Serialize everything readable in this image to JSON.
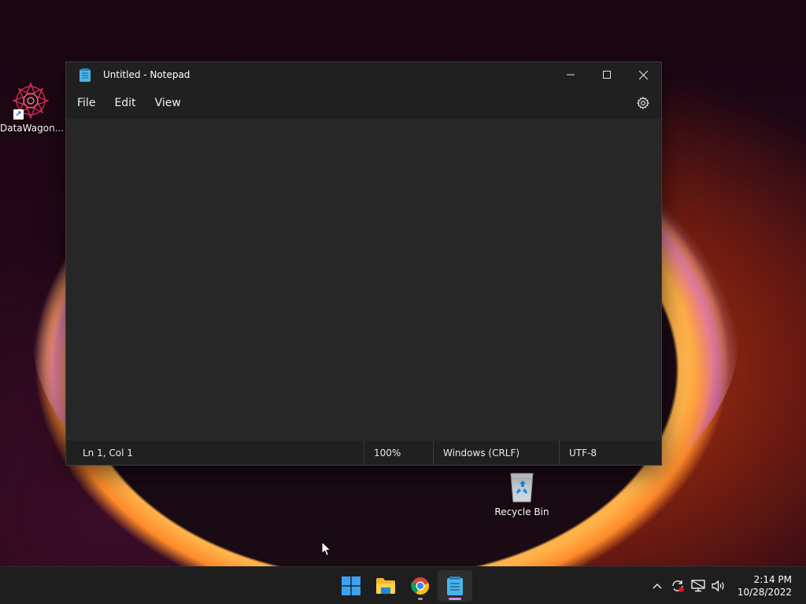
{
  "desktop": {
    "icons": [
      {
        "label": "DataWagon...",
        "icon": "datawagon-app-icon"
      },
      {
        "label": "Recycle Bin",
        "icon": "recycle-bin-icon"
      }
    ]
  },
  "window": {
    "title": "Untitled - Notepad",
    "app_icon": "notepad-icon",
    "controls": {
      "minimize": "minimize-icon",
      "maximize": "maximize-icon",
      "close": "close-icon"
    },
    "menu": [
      {
        "label": "File"
      },
      {
        "label": "Edit"
      },
      {
        "label": "View"
      }
    ],
    "settings_icon": "gear-icon",
    "editor_text": "",
    "status": {
      "position": "Ln 1, Col 1",
      "zoom": "100%",
      "line_ending": "Windows (CRLF)",
      "encoding": "UTF-8"
    }
  },
  "taskbar": {
    "apps": [
      {
        "name": "start",
        "icon": "windows-start-icon"
      },
      {
        "name": "file-explorer",
        "icon": "folder-icon"
      },
      {
        "name": "chrome",
        "icon": "chrome-icon"
      },
      {
        "name": "notepad",
        "icon": "notepad-icon",
        "active": true
      }
    ],
    "tray": {
      "icons": [
        "chevron-up-icon",
        "sync-icon",
        "network-icon",
        "volume-icon"
      ],
      "time": "2:14 PM",
      "date": "10/28/2022"
    }
  },
  "colors": {
    "window_bg": "#272727",
    "titlebar_bg": "#202020",
    "taskbar_bg": "#1e1e1e",
    "active_indicator": "#c88cf0"
  }
}
